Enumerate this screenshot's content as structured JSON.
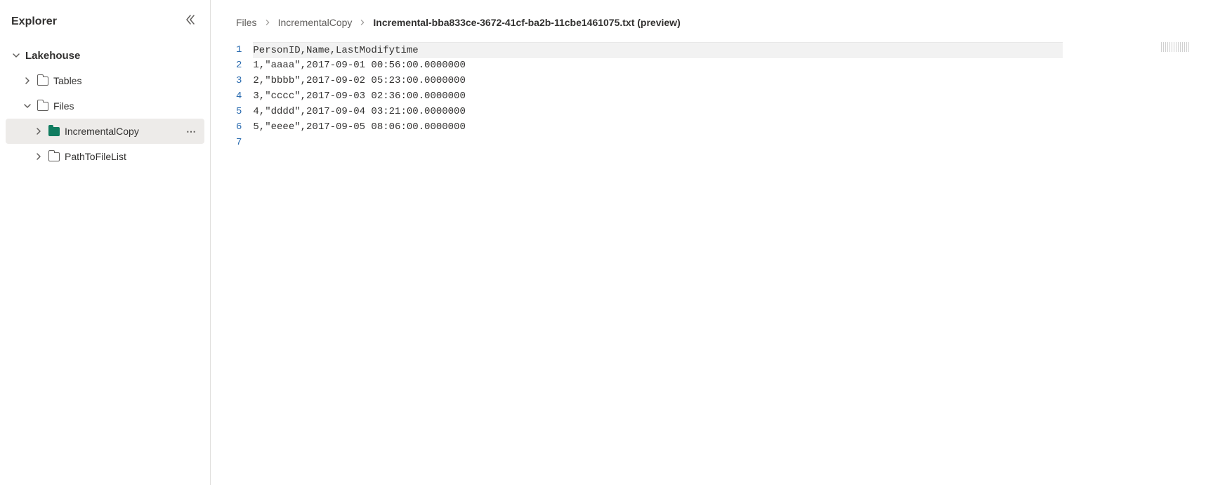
{
  "sidebar": {
    "title": "Explorer",
    "root": {
      "label": "Lakehouse"
    },
    "items": [
      {
        "label": "Tables"
      },
      {
        "label": "Files"
      },
      {
        "label": "IncrementalCopy"
      },
      {
        "label": "PathToFileList"
      }
    ]
  },
  "breadcrumb": {
    "items": [
      {
        "label": "Files"
      },
      {
        "label": "IncrementalCopy"
      },
      {
        "label": "Incremental-bba833ce-3672-41cf-ba2b-11cbe1461075.txt (preview)"
      }
    ],
    "sep": "›"
  },
  "file": {
    "lines": [
      "PersonID,Name,LastModifytime",
      "1,\"aaaa\",2017-09-01 00:56:00.0000000",
      "2,\"bbbb\",2017-09-02 05:23:00.0000000",
      "3,\"cccc\",2017-09-03 02:36:00.0000000",
      "4,\"dddd\",2017-09-04 03:21:00.0000000",
      "5,\"eeee\",2017-09-05 08:06:00.0000000",
      ""
    ]
  }
}
